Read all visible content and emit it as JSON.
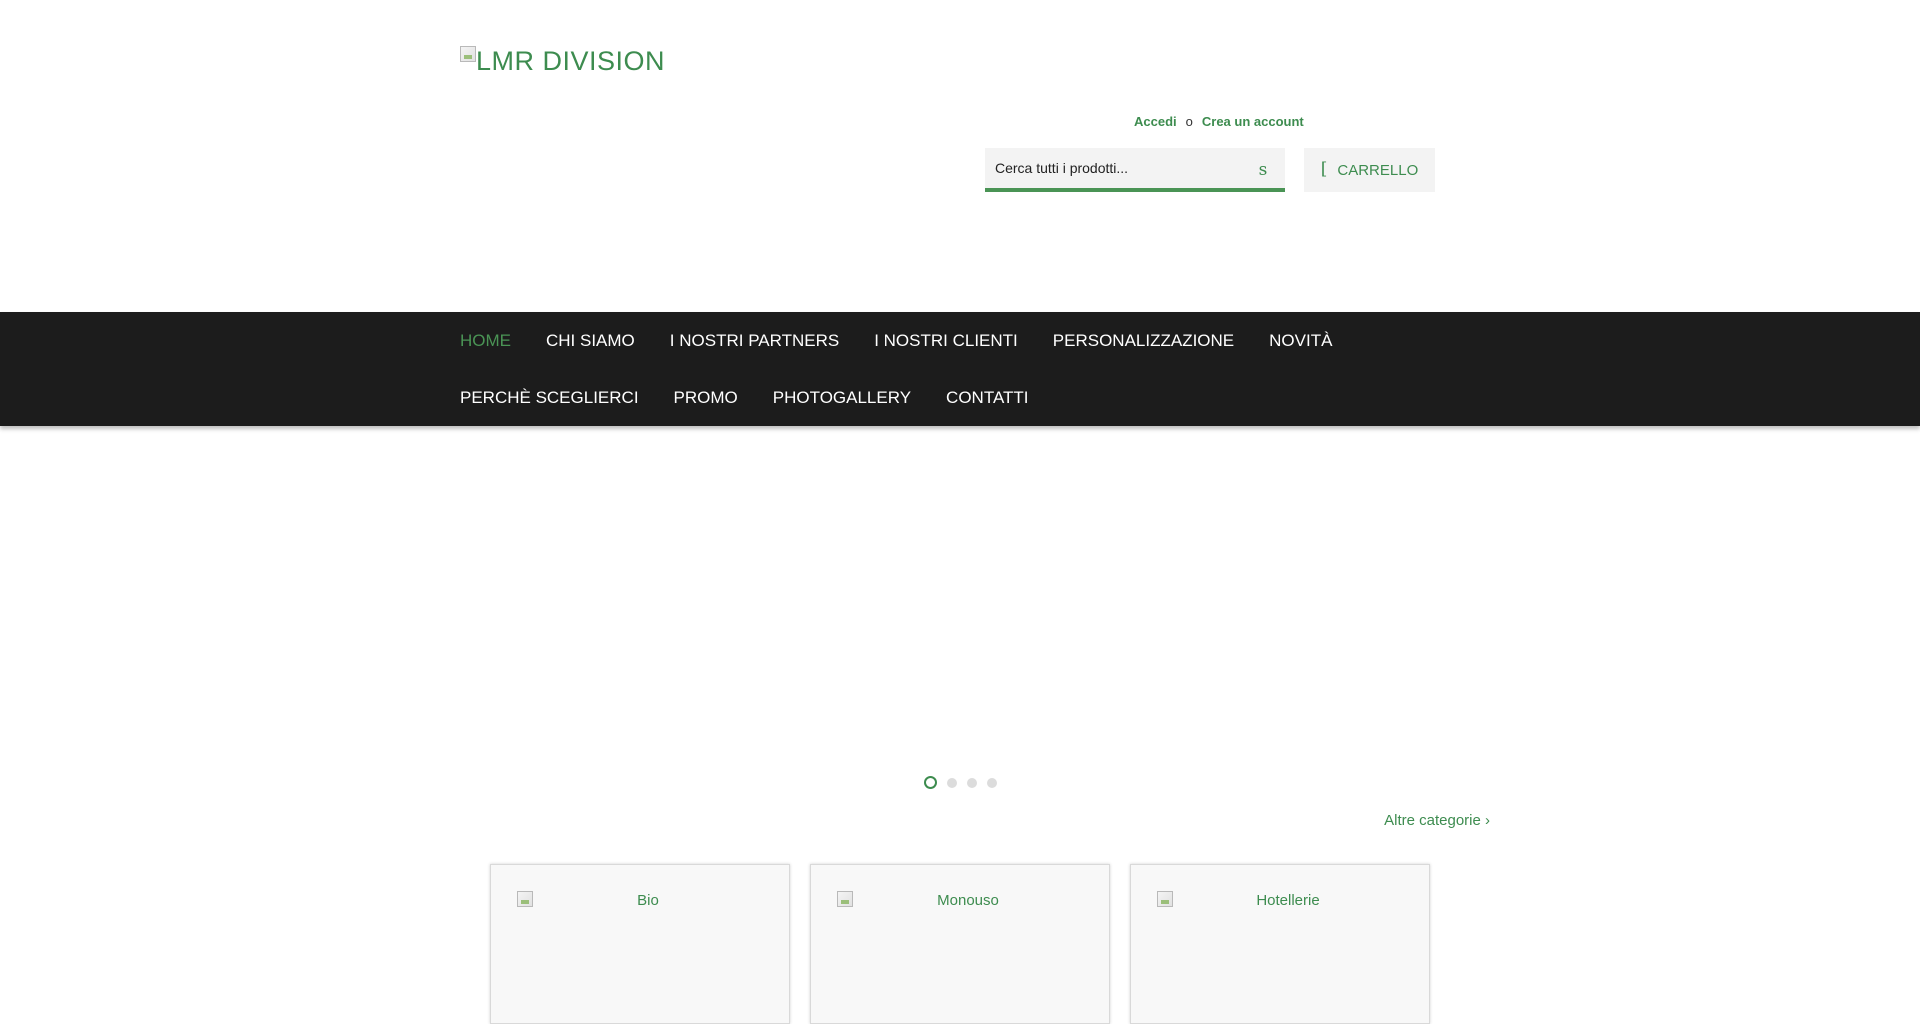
{
  "header": {
    "logo_alt": "LMR DIVISION",
    "account": {
      "login": "Accedi",
      "separator": "o",
      "register": "Crea un account"
    },
    "search": {
      "placeholder": "Cerca tutti i prodotti...",
      "icon_glyph": "s",
      "icon": "search-icon"
    },
    "cart": {
      "icon_glyph": "[",
      "icon": "cart-icon",
      "label": "CARRELLO"
    }
  },
  "nav": {
    "items": [
      {
        "label": "HOME",
        "active": true
      },
      {
        "label": "CHI SIAMO"
      },
      {
        "label": "I NOSTRI PARTNERS"
      },
      {
        "label": "I NOSTRI CLIENTI"
      },
      {
        "label": "PERSONALIZZAZIONE"
      },
      {
        "label": "NOVITÀ"
      },
      {
        "label": "PERCHÈ SCEGLIERCI"
      },
      {
        "label": "PROMO"
      },
      {
        "label": "PHOTOGALLERY"
      },
      {
        "label": "CONTATTI"
      }
    ]
  },
  "slider": {
    "slide_count": 4,
    "active_index": 0
  },
  "categories": {
    "more_link": "Altre categorie ›",
    "items": [
      {
        "label": "Bio"
      },
      {
        "label": "Monouso"
      },
      {
        "label": "Hotellerie"
      }
    ]
  },
  "colors": {
    "accent": "#3d8c4f",
    "nav_bg": "#1c1c1c",
    "field_bg": "#f3f3f3"
  }
}
